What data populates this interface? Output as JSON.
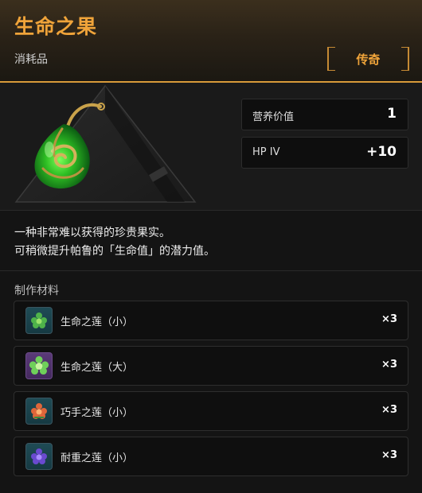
{
  "item": {
    "name": "生命之果",
    "category": "消耗品",
    "rarity": "传奇",
    "rarity_color": "#f0a43a"
  },
  "stats": [
    {
      "label": "营养价值",
      "value": "1"
    },
    {
      "label": "HP IV",
      "value": "+10"
    }
  ],
  "description": {
    "line1": "一种非常难以获得的珍贵果实。",
    "line2": "可稍微提升帕鲁的「生命值」的潜力值。"
  },
  "materials": {
    "title": "制作材料",
    "items": [
      {
        "name": "生命之莲（小）",
        "qty": "×3",
        "icon": "green-lotus-icon",
        "bg": "teal"
      },
      {
        "name": "生命之莲（大）",
        "qty": "×3",
        "icon": "green-lotus-large-icon",
        "bg": "purple"
      },
      {
        "name": "巧手之莲（小）",
        "qty": "×3",
        "icon": "orange-lotus-icon",
        "bg": "teal"
      },
      {
        "name": "耐重之莲（小）",
        "qty": "×3",
        "icon": "purple-lotus-icon",
        "bg": "teal"
      }
    ]
  },
  "colors": {
    "accent": "#d89a3a",
    "background": "#141414",
    "panel": "#0f0f0f"
  }
}
